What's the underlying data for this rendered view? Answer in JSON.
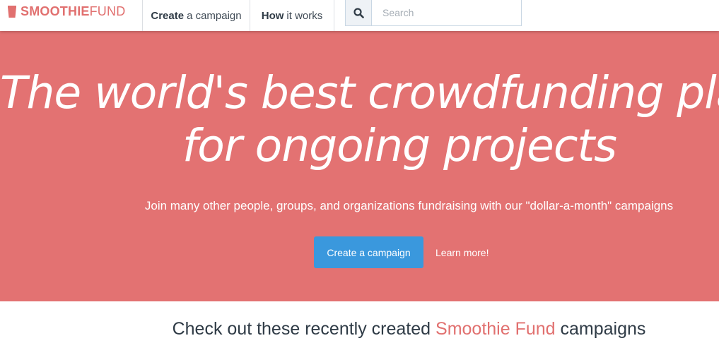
{
  "brand": {
    "part1": "SMOOTHIE",
    "part2": "FUND",
    "icon": "cup-icon",
    "color": "#e1706f"
  },
  "nav": {
    "create": {
      "bold": "Create",
      "rest": "a campaign"
    },
    "how": {
      "bold": "How",
      "rest": "it works"
    }
  },
  "search": {
    "placeholder": "Search",
    "value": "",
    "icon": "search-icon"
  },
  "hero": {
    "title_line1": "The world's best crowdfunding platform",
    "title_line2": "for ongoing projects",
    "subtitle": "Join many other people, groups, and organizations fundraising with our \"dollar-a-month\" campaigns",
    "primary_button": "Create a campaign",
    "secondary_link": "Learn more!",
    "background_color": "#e37272",
    "button_color": "#3a98dd"
  },
  "section": {
    "heading_before": "Check out these recently created",
    "heading_accent": "Smoothie Fund",
    "heading_after": "campaigns"
  }
}
